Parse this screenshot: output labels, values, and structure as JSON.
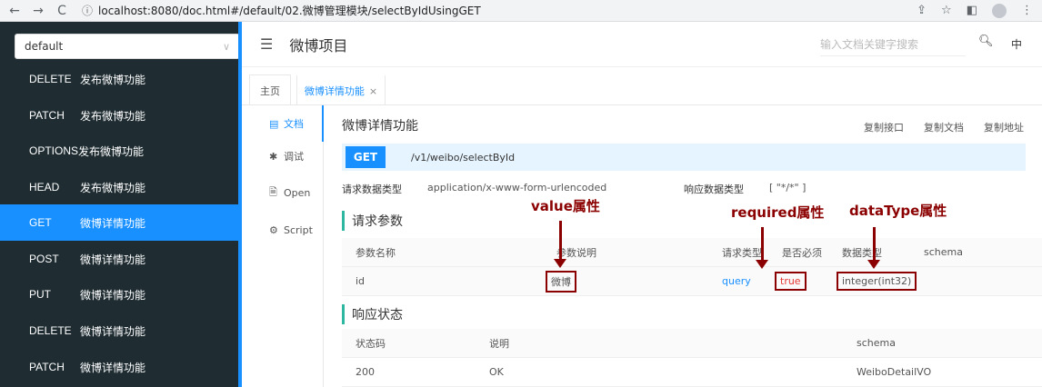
{
  "browser": {
    "back": "←",
    "forward": "→",
    "reload": "C",
    "url": "localhost:8080/doc.html#/default/02.微博管理模块/selectByIdUsingGET"
  },
  "sidebar": {
    "group": "default",
    "items": [
      {
        "method": "DELETE",
        "label": "发布微博功能"
      },
      {
        "method": "PATCH",
        "label": "发布微博功能"
      },
      {
        "method": "OPTIONS",
        "label": "发布微博功能"
      },
      {
        "method": "HEAD",
        "label": "发布微博功能"
      },
      {
        "method": "GET",
        "label": "微博详情功能"
      },
      {
        "method": "POST",
        "label": "微博详情功能"
      },
      {
        "method": "PUT",
        "label": "微博详情功能"
      },
      {
        "method": "DELETE",
        "label": "微博详情功能"
      },
      {
        "method": "PATCH",
        "label": "微博详情功能"
      }
    ]
  },
  "header": {
    "title": "微博项目",
    "search_placeholder": "输入文档关键字搜索",
    "lang": "中"
  },
  "tabs": {
    "home": "主页",
    "current": "微博详情功能",
    "close": "×"
  },
  "subnav": [
    {
      "icon": "▤",
      "label": "文档"
    },
    {
      "icon": "✱",
      "label": "调试"
    },
    {
      "icon": "🗎",
      "label": "Open"
    },
    {
      "icon": "⚙",
      "label": "Script"
    }
  ],
  "api": {
    "title": "微博详情功能",
    "copy_api": "复制接口",
    "copy_doc": "复制文档",
    "copy_addr": "复制地址",
    "method": "GET",
    "path": "/v1/weibo/selectById",
    "req_type_label": "请求数据类型",
    "req_type": "application/x-www-form-urlencoded",
    "resp_type_label": "响应数据类型",
    "resp_type": "[ \"*/*\" ]"
  },
  "params": {
    "section": "请求参数",
    "headers": [
      "参数名称",
      "参数说明",
      "请求类型",
      "是否必须",
      "数据类型",
      "schema"
    ],
    "rows": [
      {
        "name": "id",
        "desc": "微博",
        "in": "query",
        "required": "true",
        "type": "integer(int32)",
        "schema": ""
      }
    ]
  },
  "responses": {
    "section": "响应状态",
    "headers": [
      "状态码",
      "说明",
      "schema"
    ],
    "rows": [
      {
        "code": "200",
        "desc": "OK",
        "schema": "WeiboDetailVO"
      }
    ]
  },
  "annotations": {
    "value": "value属性",
    "required": "required属性",
    "datatype": "dataType属性"
  },
  "colors": {
    "accent": "#1890ff",
    "sidebar": "#1f2d33",
    "annotation": "#8b0000"
  }
}
